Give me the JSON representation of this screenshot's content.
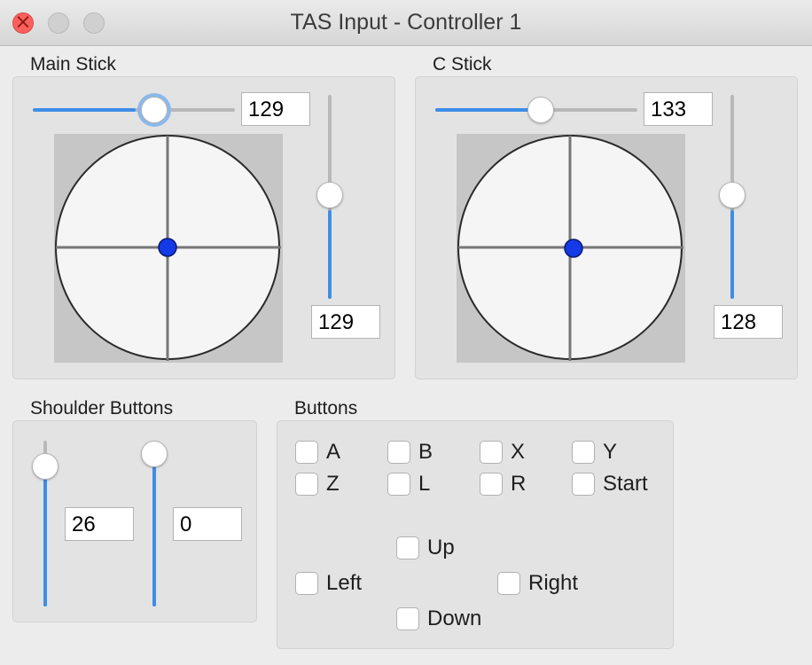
{
  "window": {
    "title": "TAS Input - Controller 1"
  },
  "main_stick": {
    "label": "Main Stick",
    "x_value": "129",
    "y_value": "129"
  },
  "c_stick": {
    "label": "C Stick",
    "x_value": "133",
    "y_value": "128"
  },
  "shoulder": {
    "label": "Shoulder Buttons",
    "left_value": "26",
    "right_value": "0"
  },
  "buttons": {
    "label": "Buttons",
    "a": "A",
    "b": "B",
    "x": "X",
    "y": "Y",
    "z": "Z",
    "l": "L",
    "r": "R",
    "start": "Start",
    "up": "Up",
    "left": "Left",
    "right": "Right",
    "down": "Down"
  },
  "colors": {
    "accent": "#3e8ee8",
    "stick_dot": "#1439e6",
    "close": "#fc605c"
  }
}
